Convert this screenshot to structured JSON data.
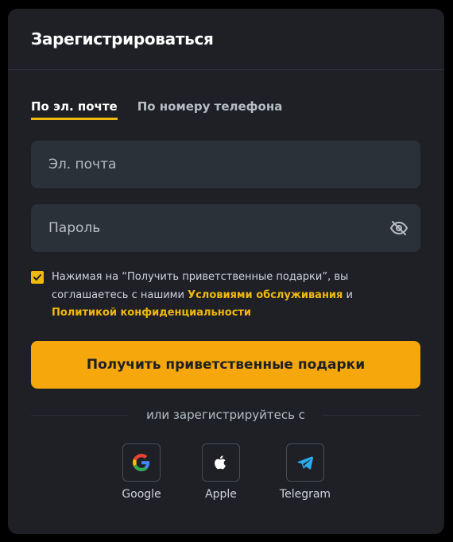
{
  "header": {
    "title": "Зарегистрироваться"
  },
  "tabs": [
    {
      "label": "По эл. почте",
      "active": true
    },
    {
      "label": "По номеру телефона",
      "active": false
    }
  ],
  "fields": {
    "email": {
      "placeholder": "Эл. почта",
      "value": ""
    },
    "password": {
      "placeholder": "Пароль",
      "value": ""
    }
  },
  "consent": {
    "checked": true,
    "text_before": "Нажимая на “Получить приветственные подарки”, вы соглашаетесь с нашими ",
    "terms_link": "Условиями обслуживания",
    "and": " и ",
    "privacy_link": "Политикой конфиденциальности"
  },
  "cta": {
    "label": "Получить приветственные подарки"
  },
  "divider": {
    "text": "или зарегистрируйтесь с"
  },
  "social": [
    {
      "label": "Google",
      "icon": "google-icon"
    },
    {
      "label": "Apple",
      "icon": "apple-icon"
    },
    {
      "label": "Telegram",
      "icon": "telegram-icon"
    }
  ],
  "colors": {
    "accent": "#f0b90b",
    "cta": "#f5a70c",
    "card": "#1e2026",
    "input": "#2b3139"
  }
}
